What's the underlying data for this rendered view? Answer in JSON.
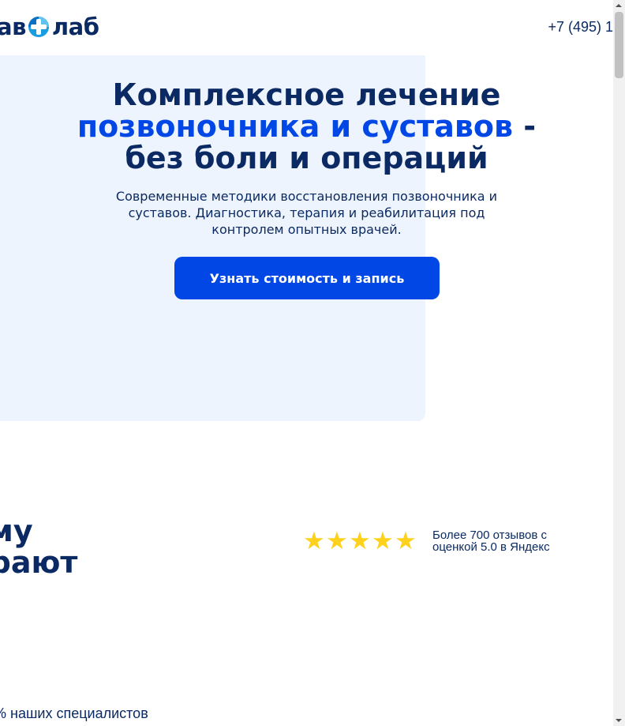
{
  "header": {
    "logo_left": "ав",
    "logo_right": "лаб",
    "phone": "+7 (495) 1"
  },
  "hero": {
    "title_line1": "Комплексное лечение",
    "title_accent": "позвоночника и суставов",
    "title_dash": " -",
    "title_line3": "без боли и операций",
    "subtitle": "Современные методики восстановления позвоночника и суставов. Диагностика, терапия и реабилитация под контролем опытных врачей.",
    "cta_label": "Узнать стоимость и запись"
  },
  "why": {
    "line1": "ему",
    "line2": "ирают"
  },
  "rating": {
    "stars": 5,
    "text_line1": "Более 700 отзывов с",
    "text_line2": "оценкой 5.0 в Яндекс",
    "star_color": "#fdd11c"
  },
  "specialists": {
    "text": "% наших специалистов"
  },
  "colors": {
    "brand_dark": "#0b2a63",
    "brand_blue": "#0047e6",
    "hero_bg": "#eef4fd"
  }
}
